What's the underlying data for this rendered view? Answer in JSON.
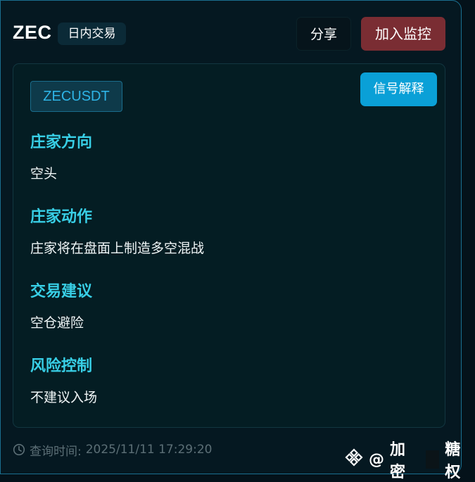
{
  "header": {
    "title": "ZEC",
    "type_badge": "日内交易",
    "share_label": "分享",
    "watch_label": "加入监控"
  },
  "panel": {
    "symbol": "ZECUSDT",
    "explain_label": "信号解释",
    "sections": [
      {
        "heading": "庄家方向",
        "body": "空头"
      },
      {
        "heading": "庄家动作",
        "body": "庄家将在盘面上制造多空混战"
      },
      {
        "heading": "交易建议",
        "body": "空仓避险"
      },
      {
        "heading": "风险控制",
        "body": "不建议入场"
      }
    ]
  },
  "footer": {
    "query_time_label": "查询时间:",
    "query_time_value": "2025/11/11 17:29:20"
  },
  "watermark": {
    "at": "@",
    "name_part1": "加密",
    "name_part2": "糖权"
  },
  "colors": {
    "accent": "#38cfe6",
    "watch_button": "#7a2d33",
    "explain_button": "#0aa0d7",
    "symbol_text": "#2eb4e6"
  },
  "icons": {
    "footer": "clock-icon",
    "watermark": "binance-diamond-icon"
  }
}
